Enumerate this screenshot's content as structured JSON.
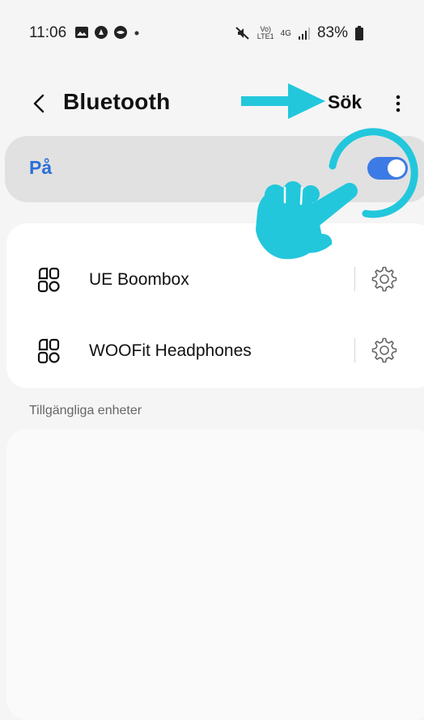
{
  "status_bar": {
    "time": "11:06",
    "network_top": "Vo)",
    "network_bottom": "LTE1",
    "data_type": "4G",
    "battery": "83%"
  },
  "header": {
    "title": "Bluetooth",
    "search_label": "Sök"
  },
  "bluetooth_toggle": {
    "label": "På",
    "enabled": true,
    "accent_color": "#3c7ae5"
  },
  "paired_devices": [
    {
      "name": "UE Boombox",
      "icon": "device-icon"
    },
    {
      "name": "WOOFit Headphones",
      "icon": "device-icon"
    }
  ],
  "available_section": {
    "header": "Tillgängliga enheter"
  },
  "annotations": {
    "color": "#22c7dc",
    "arrow_icon": "arrow-right-icon",
    "hand_icon": "pointing-hand-icon"
  }
}
